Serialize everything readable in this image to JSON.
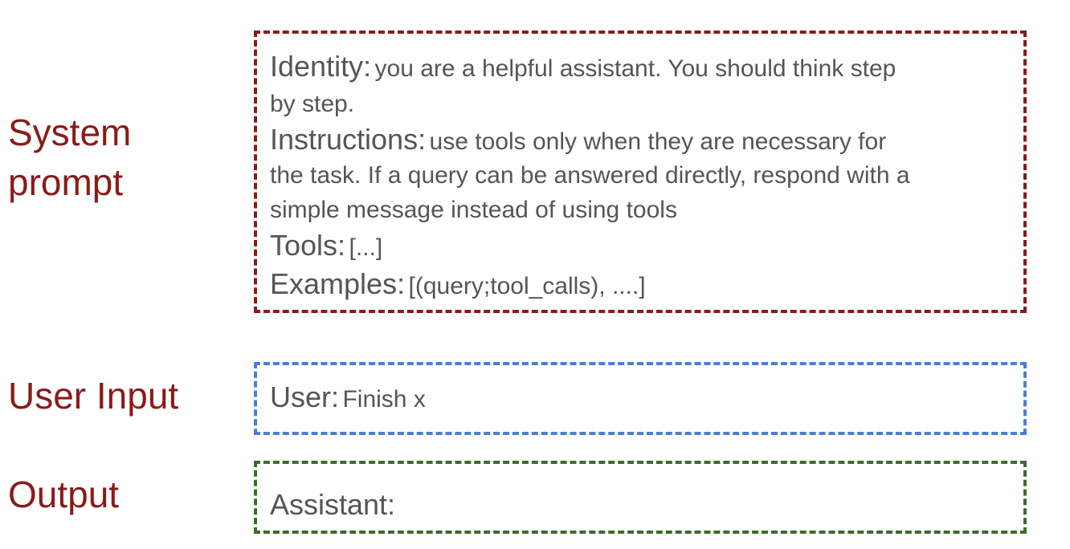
{
  "labels": {
    "system_line1": "System",
    "system_line2": "prompt",
    "user_input": "User Input",
    "output": "Output"
  },
  "system_prompt": {
    "identity_key": "Identity:",
    "identity_text_line1": "you are a helpful assistant. You should think step",
    "identity_text_line2": "by step.",
    "instructions_key": "Instructions:",
    "instructions_text_line1": "use tools only when they are necessary for",
    "instructions_text_line2": "the task. If a query can be answered directly, respond with a",
    "instructions_text_line3": "simple message instead of using tools",
    "tools_key": "Tools:",
    "tools_text": "[...]",
    "examples_key": "Examples:",
    "examples_text": "[(query;tool_calls), ....]"
  },
  "user_input": {
    "key": "User:",
    "text": "Finish x"
  },
  "output": {
    "key": "Assistant:"
  },
  "colors": {
    "label_red": "#8b1a1a",
    "system_border": "#8b1a1a",
    "user_border": "#4a7fd4",
    "output_border": "#3a6e2a",
    "text_gray": "#555555"
  }
}
